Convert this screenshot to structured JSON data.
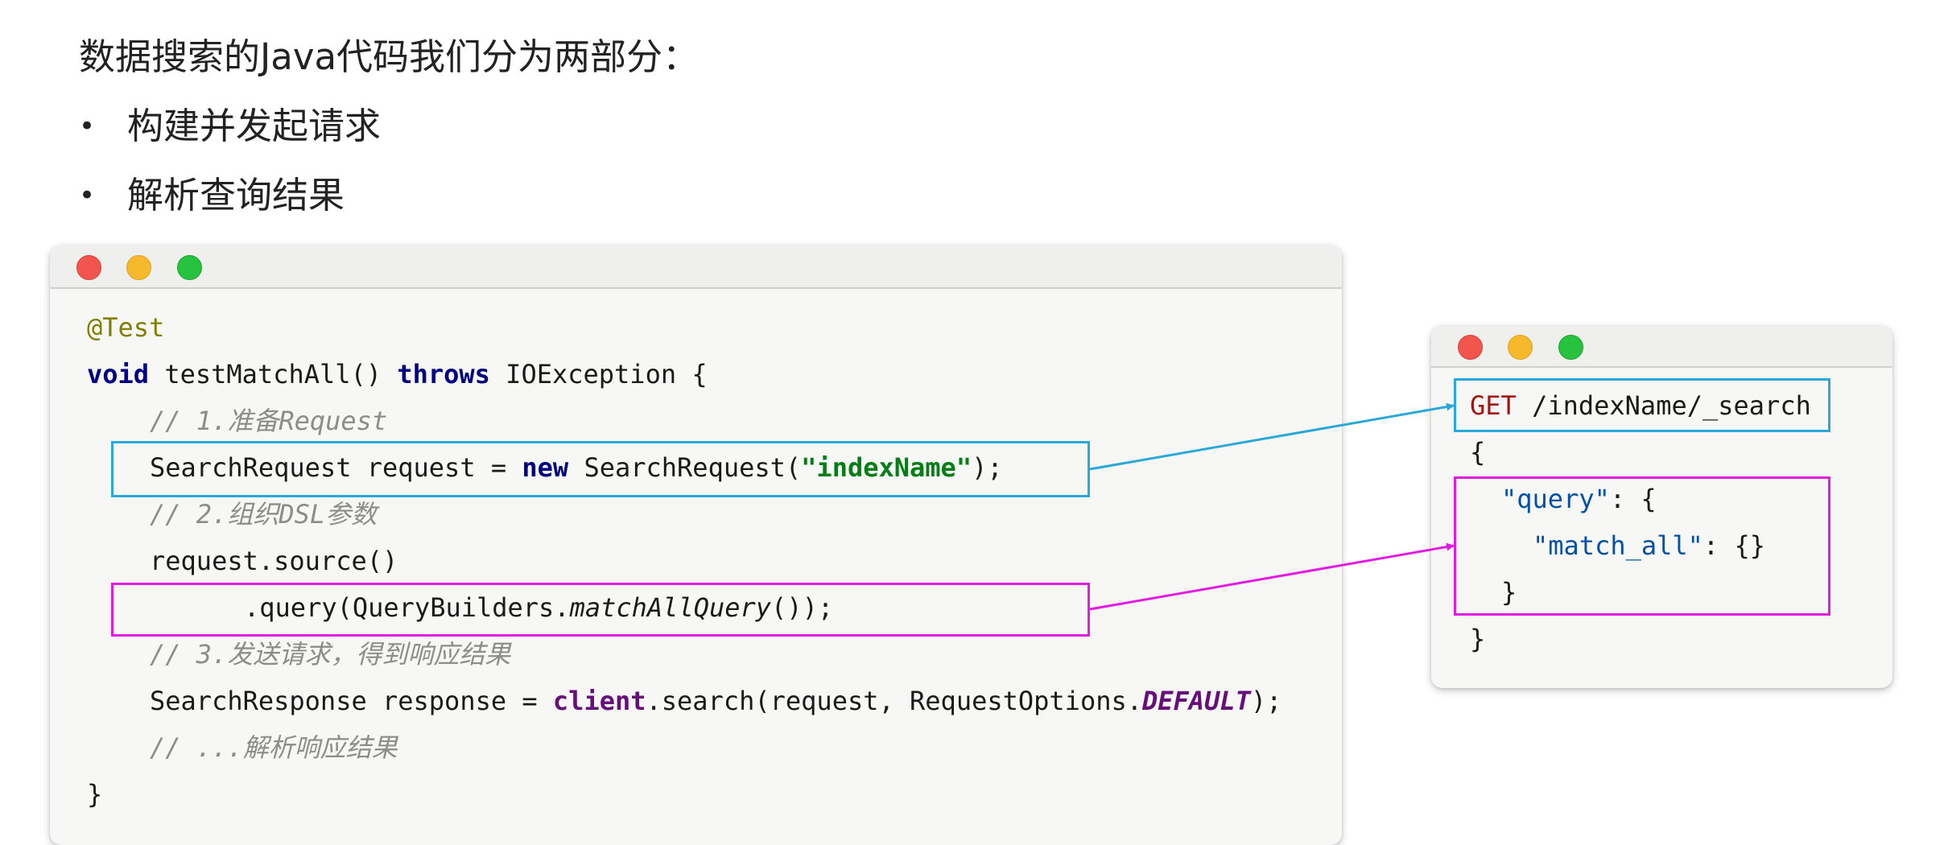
{
  "intro": {
    "heading": "数据搜索的Java代码我们分为两部分：",
    "bullet_symbol": "•",
    "bullets": [
      "构建并发起请求",
      "解析查询结果"
    ]
  },
  "java_window": {
    "lines": {
      "l1": {
        "annotation": "@Test"
      },
      "l2": {
        "kw1": "void",
        "t1": " testMatchAll() ",
        "kw2": "throws",
        "t2": " IOException {"
      },
      "l3": {
        "comment": "// 1.准备Request"
      },
      "l4": {
        "t1": "SearchRequest request = ",
        "kw": "new",
        "t2": " SearchRequest(",
        "str": "\"indexName\"",
        "t3": ");"
      },
      "l5": {
        "comment": "// 2.组织DSL参数"
      },
      "l6": {
        "t1": "request.source()"
      },
      "l7": {
        "t1": ".query(QueryBuilders.",
        "method": "matchAllQuery",
        "t2": "());"
      },
      "l8": {
        "comment": "// 3.发送请求，得到响应结果"
      },
      "l9": {
        "t1": "SearchResponse response = ",
        "field": "client",
        "t2": ".search(request, RequestOptions.",
        "sfield": "DEFAULT",
        "t3": ");"
      },
      "l10": {
        "comment": "// ...解析响应结果"
      },
      "l11": {
        "t1": "}"
      }
    }
  },
  "dsl_window": {
    "lines": {
      "l1": {
        "method": "GET",
        "path": " /indexName/_search"
      },
      "l2": {
        "t": "{"
      },
      "l3": {
        "key": "\"query\"",
        "t": ": {"
      },
      "l4": {
        "key": "\"match_all\"",
        "t": ": {}"
      },
      "l5": {
        "t": "}"
      },
      "l6": {
        "t": "}"
      }
    }
  },
  "colors": {
    "highlight_blue": "#2aa8d8",
    "highlight_pink": "#e11be0",
    "keyword": "#000080",
    "string": "#067d17",
    "comment": "#8c8c8c",
    "annotation": "#808000"
  }
}
